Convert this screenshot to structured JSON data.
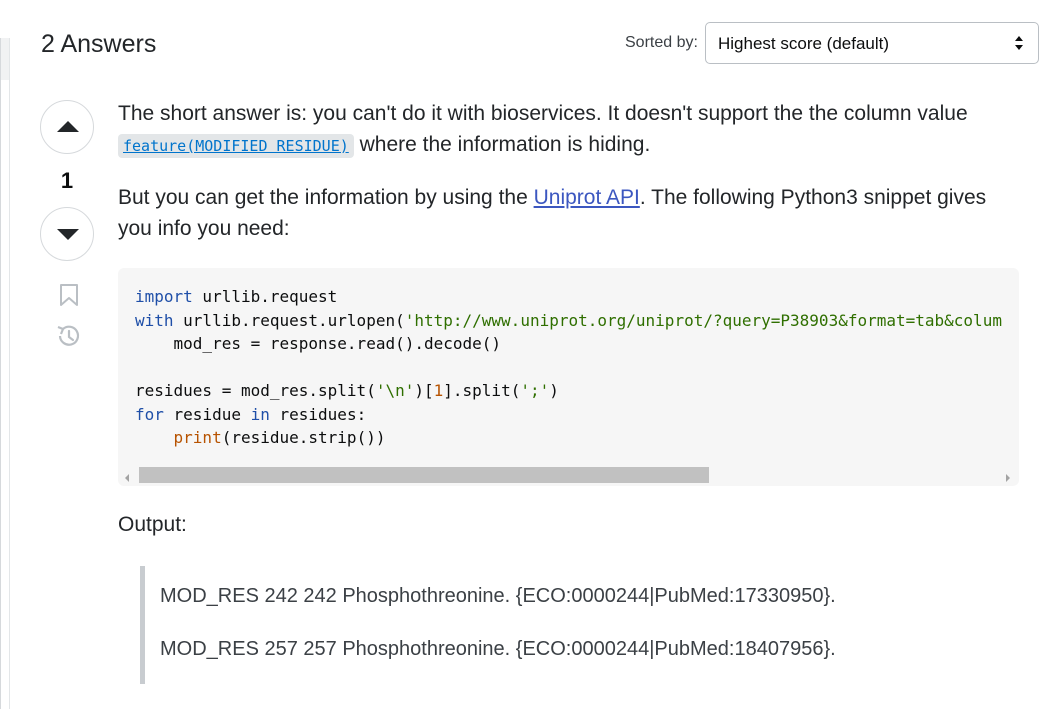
{
  "header": {
    "answers_count_label": "2 Answers",
    "sort_label": "Sorted by:",
    "sort_value": "Highest score (default)"
  },
  "answer": {
    "score": "1",
    "paragraph1": {
      "text_before": "The short answer is: you can't do it with bioservices. It doesn't support the the column value",
      "inline_code": "feature(MODIFIED RESIDUE)",
      "text_after": " where the information is hiding."
    },
    "paragraph2": {
      "text_before": "But you can get the information by using the ",
      "link": "Uniprot API",
      "text_after": ". The following Python3 snippet gives you info you need:"
    },
    "code": {
      "line1_kw": "import",
      "line1_rest": " urllib.request",
      "line2_kw": "with",
      "line2_mid": " urllib.request.urlopen(",
      "line2_str": "'http://www.uniprot.org/uniprot/?query=P38903&format=tab&colum",
      "line3": "    mod_res = response.read().decode()",
      "line5_a": "residues = mod_res.split(",
      "line5_str1": "'\\n'",
      "line5_b": ")[",
      "line5_num": "1",
      "line5_c": "].split(",
      "line5_str2": "';'",
      "line5_d": ")",
      "line6_kw1": "for",
      "line6_mid": " residue ",
      "line6_kw2": "in",
      "line6_end": " residues:",
      "line7_indent": "    ",
      "line7_bi": "print",
      "line7_rest": "(residue.strip())"
    },
    "output_label": "Output:",
    "output_lines": [
      "MOD_RES 242 242 Phosphothreonine. {ECO:0000244|PubMed:17330950}.",
      "MOD_RES 257 257 Phosphothreonine. {ECO:0000244|PubMed:18407956}."
    ]
  },
  "icons": {
    "upvote": "triangle-up-icon",
    "downvote": "triangle-down-icon",
    "bookmark": "bookmark-icon",
    "history": "history-icon",
    "select_arrows": "updown-caret-icon"
  },
  "colors": {
    "link": "#3c57c0",
    "code_background": "#f6f6f6",
    "inline_code_text": "#0074cc"
  }
}
